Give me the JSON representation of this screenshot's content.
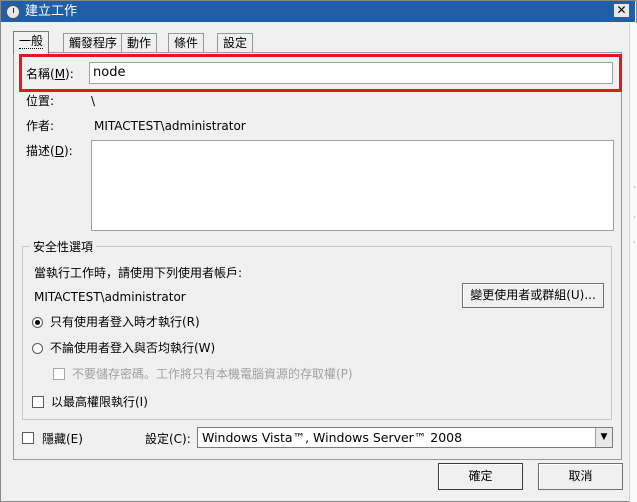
{
  "window": {
    "title": "建立工作",
    "close_glyph": "✕"
  },
  "tabs": [
    {
      "label": "一般"
    },
    {
      "label": "觸發程序"
    },
    {
      "label": "動作"
    },
    {
      "label": "條件"
    },
    {
      "label": "設定"
    }
  ],
  "general": {
    "name_label": "名稱(",
    "name_hotkey": "M",
    "name_label_end": "):",
    "name_value": "node",
    "location_label": "位置:",
    "location_value": "\\",
    "author_label": "作者:",
    "author_value": "MITACTEST\\administrator",
    "description_label": "描述(",
    "description_hotkey": "D",
    "description_label_end": "):",
    "description_value": ""
  },
  "security": {
    "group_title": "安全性選項",
    "run_as_prompt": "當執行工作時，請使用下列使用者帳戶:",
    "run_as_user": "MITACTEST\\administrator",
    "change_user_button": "變更使用者或群組(U)...",
    "option_logged_on": "只有使用者登入時才執行(R)",
    "option_logged_on_checked": true,
    "option_whether": "不論使用者登入與否均執行(W)",
    "option_whether_checked": false,
    "no_store_password": "不要儲存密碼。工作將只有本機電腦資源的存取權(P)",
    "highest_privileges": "以最高權限執行(I)"
  },
  "footer": {
    "hidden_label": "隱藏(E)",
    "configure_label": "設定(C):",
    "configure_value": "Windows Vista™, Windows Server™ 2008",
    "ok_button": "確定",
    "cancel_button": "取消"
  },
  "icons": {
    "dropdown_arrow": "▼",
    "title_icon": "clock-icon"
  },
  "colors": {
    "highlight_border": "#e01a1a",
    "titlebar": "#1f5fa8"
  }
}
